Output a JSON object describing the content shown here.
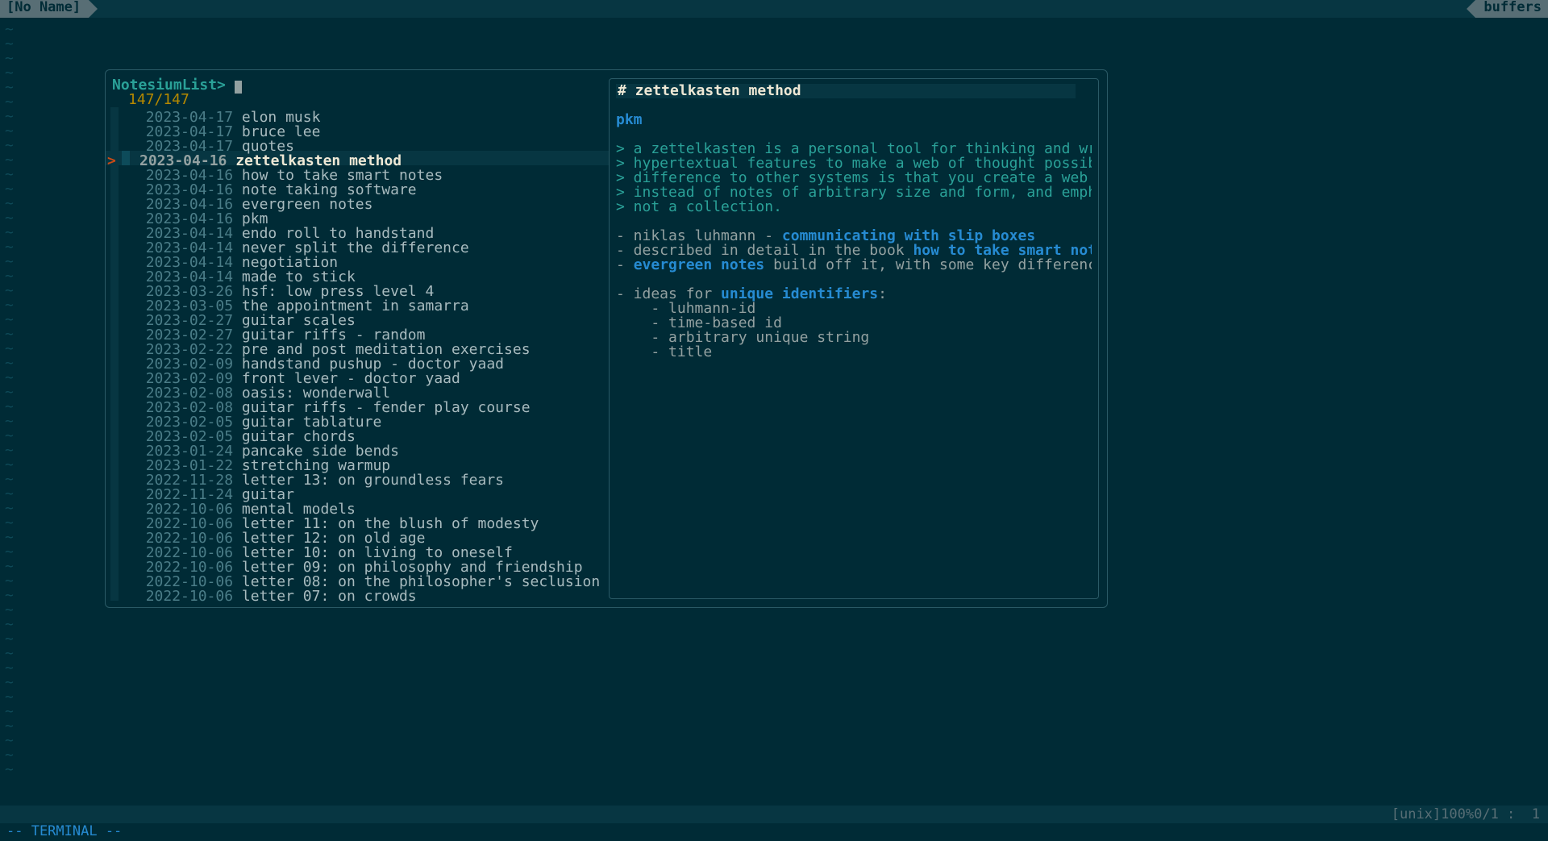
{
  "tabline": {
    "left": "[No Name]",
    "right": "buffers"
  },
  "fzf": {
    "prompt": "NotesiumList",
    "arrow": ">",
    "count": "147/147",
    "selected_index": 3,
    "items": [
      {
        "date": "2023-04-17",
        "title": "elon musk"
      },
      {
        "date": "2023-04-17",
        "title": "bruce lee"
      },
      {
        "date": "2023-04-17",
        "title": "quotes"
      },
      {
        "date": "2023-04-16",
        "title": "zettelkasten method"
      },
      {
        "date": "2023-04-16",
        "title": "how to take smart notes"
      },
      {
        "date": "2023-04-16",
        "title": "note taking software"
      },
      {
        "date": "2023-04-16",
        "title": "evergreen notes"
      },
      {
        "date": "2023-04-16",
        "title": "pkm"
      },
      {
        "date": "2023-04-14",
        "title": "endo roll to handstand"
      },
      {
        "date": "2023-04-14",
        "title": "never split the difference"
      },
      {
        "date": "2023-04-14",
        "title": "negotiation"
      },
      {
        "date": "2023-04-14",
        "title": "made to stick"
      },
      {
        "date": "2023-03-26",
        "title": "hsf: low press level 4"
      },
      {
        "date": "2023-03-05",
        "title": "the appointment in samarra"
      },
      {
        "date": "2023-02-27",
        "title": "guitar scales"
      },
      {
        "date": "2023-02-27",
        "title": "guitar riffs - random"
      },
      {
        "date": "2023-02-22",
        "title": "pre and post meditation exercises"
      },
      {
        "date": "2023-02-09",
        "title": "handstand pushup - doctor yaad"
      },
      {
        "date": "2023-02-09",
        "title": "front lever - doctor yaad"
      },
      {
        "date": "2023-02-08",
        "title": "oasis: wonderwall"
      },
      {
        "date": "2023-02-08",
        "title": "guitar riffs - fender play course"
      },
      {
        "date": "2023-02-05",
        "title": "guitar tablature"
      },
      {
        "date": "2023-02-05",
        "title": "guitar chords"
      },
      {
        "date": "2023-01-24",
        "title": "pancake side bends"
      },
      {
        "date": "2023-01-22",
        "title": "stretching warmup"
      },
      {
        "date": "2022-11-28",
        "title": "letter 13: on groundless fears"
      },
      {
        "date": "2022-11-24",
        "title": "guitar"
      },
      {
        "date": "2022-10-06",
        "title": "mental models"
      },
      {
        "date": "2022-10-06",
        "title": "letter 11: on the blush of modesty"
      },
      {
        "date": "2022-10-06",
        "title": "letter 12: on old age"
      },
      {
        "date": "2022-10-06",
        "title": "letter 10: on living to oneself"
      },
      {
        "date": "2022-10-06",
        "title": "letter 09: on philosophy and friendship"
      },
      {
        "date": "2022-10-06",
        "title": "letter 08: on the philosopher's seclusion"
      },
      {
        "date": "2022-10-06",
        "title": "letter 07: on crowds"
      }
    ]
  },
  "preview": {
    "heading": "# zettelkasten method",
    "tag": "pkm",
    "quotes": [
      "> a zettelkasten is a personal tool for thinking and writing.",
      "> hypertextual features to make a web of thought possible. th",
      "> difference to other systems is that you create a web of tho",
      "> instead of notes of arbitrary size and form, and emphasize ",
      "> not a collection."
    ],
    "b1": {
      "pre": "- niklas luhmann - ",
      "link": "communicating with slip boxes"
    },
    "b2": {
      "pre": "- described in detail in the book ",
      "link": "how to take smart notes"
    },
    "b3": {
      "pre": "- ",
      "link": "evergreen notes",
      "post": " build off it, with some key differences"
    },
    "b4": {
      "pre": "- ideas for ",
      "link": "unique identifiers",
      "post": ":"
    },
    "subs": [
      "    - luhmann-id",
      "    - time-based id",
      "    - arbitrary unique string",
      "    - title"
    ]
  },
  "status": {
    "encoding": "[unix]",
    "percent": "100%",
    "pos": "0/1 :  1"
  },
  "cmd": "-- TERMINAL --"
}
